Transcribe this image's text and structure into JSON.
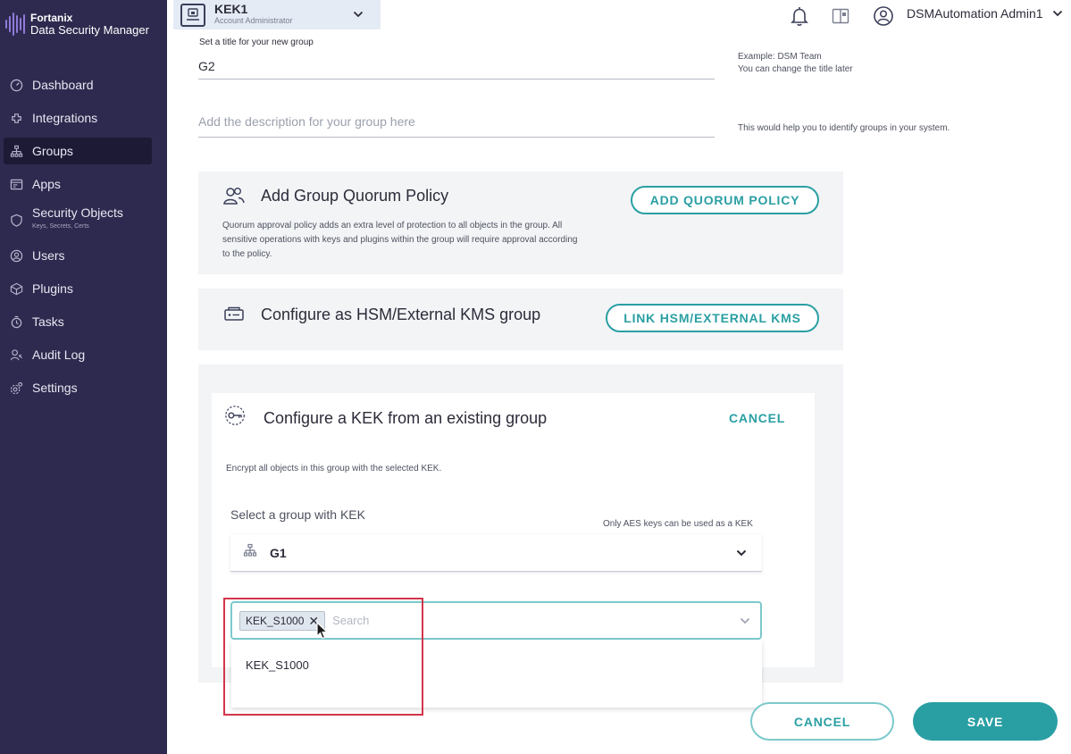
{
  "app": {
    "brand": "Fortanix",
    "product": "Data Security Manager"
  },
  "sidebar": {
    "items": [
      {
        "label": "Dashboard",
        "icon": "dashboard-icon"
      },
      {
        "label": "Integrations",
        "icon": "integrations-icon"
      },
      {
        "label": "Groups",
        "icon": "groups-icon",
        "active": true
      },
      {
        "label": "Apps",
        "icon": "apps-icon"
      },
      {
        "label": "Security Objects",
        "sublabel": "Keys, Secrets, Certs",
        "icon": "shield-icon"
      },
      {
        "label": "Users",
        "icon": "users-icon"
      },
      {
        "label": "Plugins",
        "icon": "plugins-icon"
      },
      {
        "label": "Tasks",
        "icon": "tasks-icon"
      },
      {
        "label": "Audit Log",
        "icon": "audit-log-icon"
      },
      {
        "label": "Settings",
        "icon": "settings-icon"
      }
    ]
  },
  "topbar": {
    "account_name": "KEK1",
    "account_role": "Account Administrator",
    "user_name": "DSMAutomation Admin1"
  },
  "form": {
    "title_label": "Set a title for your new group",
    "title_value": "G2",
    "title_hint_1": "Example: DSM Team",
    "title_hint_2": "You can change the title later",
    "description_placeholder": "Add the description for your group here",
    "description_hint": "This would help you to identify groups in your system."
  },
  "quorum": {
    "title": "Add Group Quorum Policy",
    "description": "Quorum approval policy adds an extra level of protection to all objects in the group. All sensitive operations with keys and plugins within the group will require approval according to the policy.",
    "button": "ADD QUORUM POLICY"
  },
  "hsm": {
    "title": "Configure as HSM/External KMS group",
    "button": "LINK HSM/EXTERNAL KMS"
  },
  "kek": {
    "title": "Configure a KEK from an existing group",
    "cancel": "CANCEL",
    "description": "Encrypt all objects in this group with the selected KEK.",
    "select_label": "Select a group with KEK",
    "only_aes_hint": "Only AES keys can be used as a KEK",
    "selected_group": "G1",
    "selected_key_chip": "KEK_S1000",
    "search_placeholder": "Search",
    "dropdown_options": [
      "KEK_S1000"
    ]
  },
  "footer": {
    "cancel": "CANCEL",
    "save": "SAVE"
  },
  "colors": {
    "sidebar_bg": "#2e2a4f",
    "accent_teal": "#2a9fa3",
    "highlight_red": "#d4354a"
  }
}
